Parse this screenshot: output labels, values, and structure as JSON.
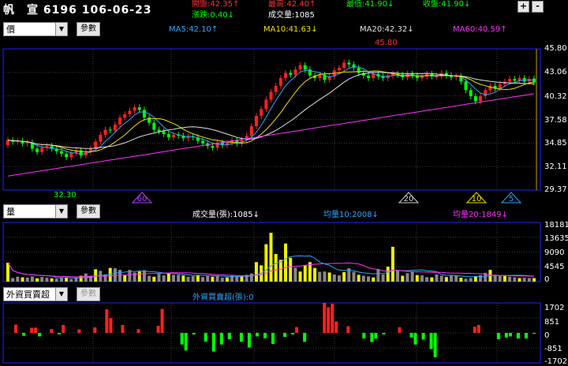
{
  "header": {
    "title": "帆　宣 6196 106-06-23",
    "cells": [
      {
        "text": "開盤:42.35↑",
        "color": "#ff3030"
      },
      {
        "text": "漲跌:0.40↓",
        "color": "#00ff00"
      },
      {
        "text": "最高:42.40↑",
        "color": "#ff3030"
      },
      {
        "text": "成交量:1085",
        "color": "#ffffff"
      },
      {
        "text": "最低:41.90↓",
        "color": "#00ff00"
      },
      {
        "text": "收盤:41.90↓",
        "color": "#00ff00"
      }
    ],
    "plus": "+",
    "minus": "-"
  },
  "price_panel": {
    "select_value": "價",
    "param_label": "參數",
    "ma_labels": [
      {
        "text": "MA5:42.10↑",
        "color": "#2aa8ff"
      },
      {
        "text": "MA10:41.63↓",
        "color": "#f0e000"
      },
      {
        "text": "MA20:42.32↓",
        "color": "#e0e0e0"
      },
      {
        "text": "MA60:40.59↑",
        "color": "#ff30ff"
      }
    ],
    "y_ticks": [
      "45.80",
      "43.06",
      "40.32",
      "37.58",
      "34.85",
      "32.11",
      "29.37"
    ],
    "high_label": "45.80",
    "low_label": "32.30",
    "markers": [
      {
        "label": "60",
        "color": "#b040ff"
      },
      {
        "label": "20",
        "color": "#d0d0d0"
      },
      {
        "label": "10",
        "color": "#f0e000"
      },
      {
        "label": "5",
        "color": "#2aa8ff"
      }
    ]
  },
  "volume_panel": {
    "select_value": "量",
    "param_label": "參數",
    "labels": [
      {
        "text": "成交量(張):1085↓",
        "color": "#ffffff"
      },
      {
        "text": "均量10:2008↓",
        "color": "#2aa8ff"
      },
      {
        "text": "均量20:1849↓",
        "color": "#ff30ff"
      }
    ],
    "y_ticks": [
      "18181",
      "13635",
      "9090",
      "4545",
      "0"
    ]
  },
  "foreign_panel": {
    "select_value": "外資買賣超",
    "param_label": "參數",
    "label": {
      "text": "外資買賣超(張):0",
      "color": "#2aa8ff"
    },
    "y_ticks": [
      "1702",
      "851",
      "0",
      "-851",
      "-1702"
    ]
  },
  "chart_data": [
    {
      "type": "candlestick",
      "title": "價",
      "ylim": [
        29.37,
        45.8
      ],
      "y_ticks": [
        45.8,
        43.06,
        40.32,
        37.58,
        34.85,
        32.11,
        29.37
      ],
      "open": [
        34.6,
        35.2,
        35.0,
        35.1,
        34.8,
        34.9,
        34.2,
        33.8,
        34.3,
        34.5,
        34.2,
        33.9,
        33.6,
        33.2,
        33.7,
        34.0,
        33.4,
        33.8,
        34.2,
        35.0,
        35.8,
        36.4,
        36.3,
        37.0,
        37.8,
        38.2,
        38.6,
        39.0,
        38.7,
        37.8,
        37.2,
        36.4,
        36.2,
        35.9,
        35.5,
        35.8,
        35.7,
        35.4,
        35.6,
        35.5,
        35.1,
        34.8,
        34.5,
        34.3,
        34.9,
        34.6,
        34.9,
        35.2,
        34.8,
        35.2,
        35.7,
        36.8,
        38.0,
        38.8,
        39.9,
        40.8,
        41.5,
        42.4,
        43.0,
        42.8,
        43.4,
        43.9,
        43.4,
        42.7,
        42.4,
        42.8,
        42.2,
        42.6,
        43.3,
        43.6,
        44.2,
        44.0,
        43.6,
        43.0,
        42.7,
        42.4,
        42.9,
        42.6,
        42.4,
        42.7,
        42.9,
        42.8,
        42.5,
        42.9,
        42.7,
        42.4,
        42.6,
        42.9,
        42.6,
        42.6,
        43.0,
        42.7,
        42.5,
        42.6,
        42.0,
        41.0,
        40.3,
        39.7,
        40.3,
        41.0,
        41.5,
        41.2,
        41.7,
        42.0,
        42.3,
        42.1,
        42.4,
        42.0,
        42.35
      ],
      "close": [
        35.2,
        35.0,
        35.1,
        34.8,
        34.9,
        34.2,
        33.8,
        34.3,
        34.5,
        34.2,
        33.9,
        33.6,
        33.2,
        33.7,
        34.0,
        33.4,
        33.8,
        34.2,
        35.0,
        35.8,
        36.4,
        36.3,
        37.0,
        37.8,
        38.2,
        38.6,
        39.0,
        38.7,
        37.8,
        37.2,
        36.4,
        36.2,
        35.9,
        35.5,
        35.8,
        35.7,
        35.4,
        35.6,
        35.5,
        35.1,
        34.8,
        34.5,
        34.3,
        34.9,
        34.6,
        34.9,
        35.2,
        34.8,
        35.2,
        35.7,
        36.8,
        38.0,
        38.8,
        39.9,
        40.8,
        41.5,
        42.4,
        43.0,
        42.8,
        43.4,
        43.9,
        43.4,
        42.7,
        42.4,
        42.8,
        42.2,
        42.6,
        43.3,
        43.6,
        44.2,
        44.0,
        43.6,
        43.0,
        42.7,
        42.4,
        42.9,
        42.6,
        42.4,
        42.7,
        42.9,
        42.8,
        42.5,
        42.9,
        42.7,
        42.4,
        42.6,
        42.9,
        42.6,
        42.6,
        43.0,
        42.7,
        42.5,
        42.6,
        42.0,
        41.0,
        40.3,
        39.7,
        40.3,
        41.0,
        41.5,
        41.2,
        41.7,
        42.0,
        42.3,
        42.1,
        42.4,
        42.0,
        42.3,
        41.9
      ],
      "high": 45.8,
      "low": 32.3
    },
    {
      "type": "bar",
      "title": "成交量(張)",
      "ylim": [
        0,
        18181
      ],
      "values": [
        5800,
        1100,
        1500,
        1300,
        1200,
        1600,
        1000,
        1400,
        1200,
        1000,
        900,
        1100,
        1300,
        800,
        1100,
        1800,
        2500,
        1800,
        3800,
        3300,
        2200,
        4200,
        4100,
        3600,
        1900,
        3600,
        2800,
        3100,
        3500,
        1800,
        1500,
        2400,
        1900,
        2600,
        2100,
        2100,
        1900,
        1500,
        1700,
        1900,
        1400,
        1700,
        1500,
        1800,
        1200,
        1300,
        1800,
        1500,
        1900,
        2100,
        2500,
        6000,
        5000,
        11500,
        15000,
        8500,
        6700,
        11700,
        7300,
        4300,
        3100,
        5000,
        6000,
        4200,
        3000,
        3100,
        2800,
        2200,
        1900,
        2900,
        4100,
        3000,
        2100,
        1800,
        1600,
        1300,
        3800,
        2200,
        4600,
        10700,
        3300,
        1800,
        2600,
        3000,
        2000,
        1900,
        1400,
        1300,
        2200,
        1800,
        1400,
        1800,
        1900,
        1200,
        900,
        1100,
        1700,
        2000,
        2700,
        3600,
        2100,
        1700,
        1700,
        1500,
        1300,
        1100,
        1200,
        1100,
        1085
      ],
      "ma10": [
        2008
      ],
      "ma20": [
        1849
      ]
    },
    {
      "type": "bar",
      "title": "外資買賣超(張)",
      "ylim": [
        -1702,
        1702
      ],
      "values": [
        0,
        0,
        470,
        0,
        -160,
        0,
        290,
        300,
        -200,
        0,
        0,
        220,
        0,
        -90,
        450,
        0,
        0,
        0,
        200,
        0,
        0,
        0,
        310,
        0,
        0,
        1340,
        840,
        0,
        0,
        450,
        0,
        0,
        0,
        210,
        0,
        0,
        0,
        0,
        400,
        1360,
        0,
        0,
        0,
        0,
        -660,
        -1000,
        0,
        -90,
        0,
        0,
        -500,
        0,
        -1060,
        0,
        -660,
        0,
        -360,
        0,
        0,
        -500,
        0,
        -830,
        0,
        -200,
        0,
        -310,
        0,
        -630,
        0,
        0,
        -230,
        0,
        -90,
        330,
        0,
        -510,
        0,
        0,
        0,
        0,
        1700,
        1450,
        1650,
        650,
        0,
        0,
        380,
        0,
        0,
        0,
        -320,
        0,
        -520,
        -330,
        0,
        -90,
        0,
        0,
        0,
        320,
        0,
        0,
        -260,
        -660,
        0,
        -380,
        0,
        -920,
        -1380,
        0,
        0,
        0,
        0,
        0,
        0,
        0,
        0,
        0,
        350,
        450,
        0,
        0,
        0,
        0,
        -360,
        0,
        -260,
        -200,
        0,
        -320,
        0,
        -320,
        0,
        -50
      ]
    }
  ]
}
